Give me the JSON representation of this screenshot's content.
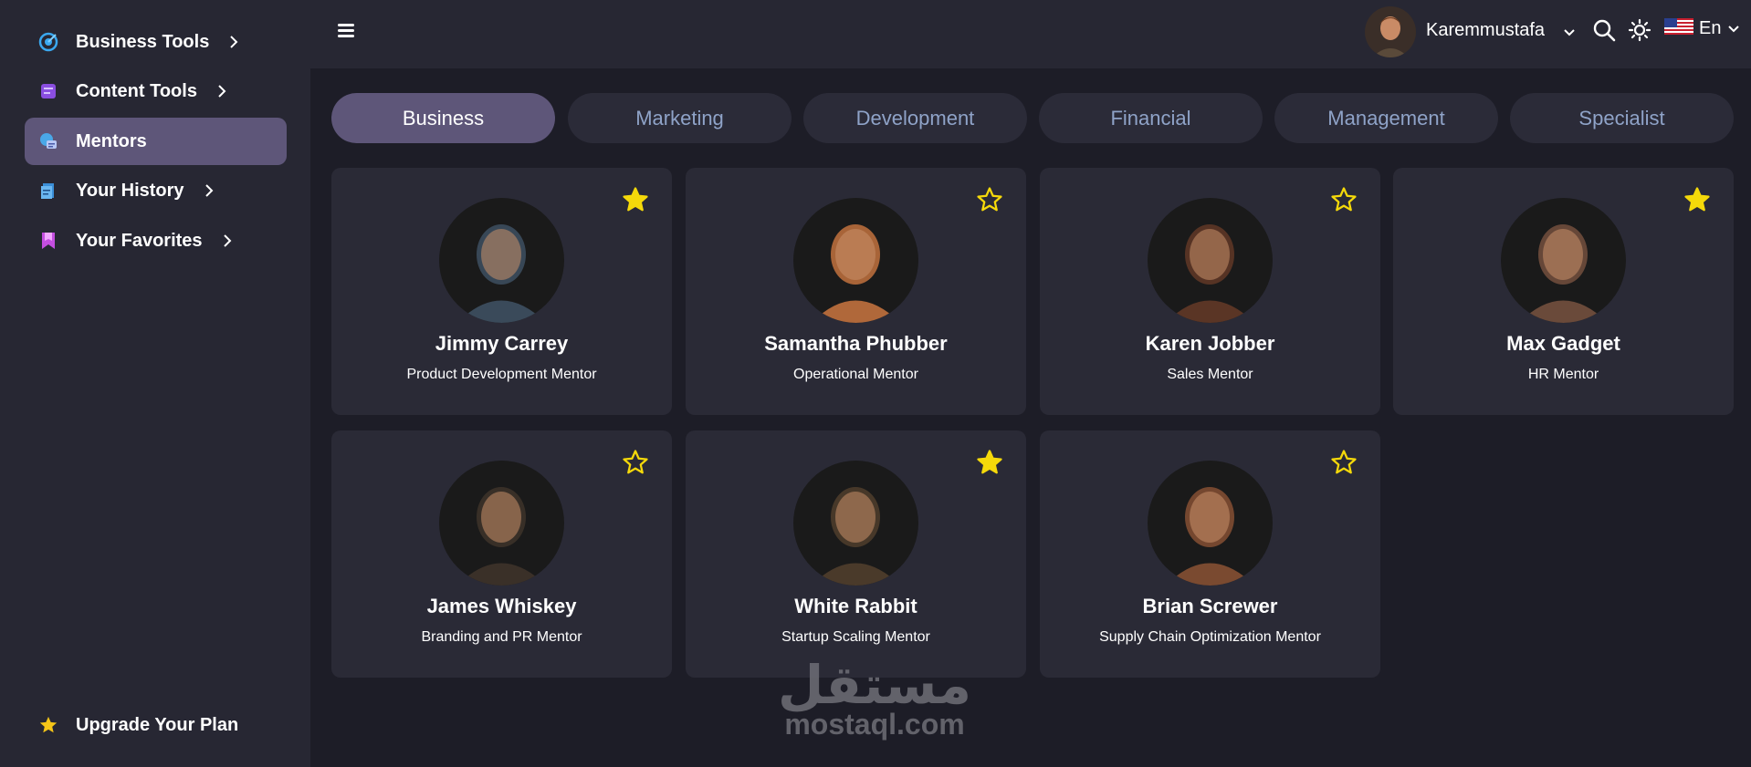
{
  "sidebar": {
    "items": [
      {
        "label": "Business Tools",
        "icon": "target-icon",
        "active": false,
        "has_chevron": true
      },
      {
        "label": "Content Tools",
        "icon": "content-icon",
        "active": false,
        "has_chevron": true
      },
      {
        "label": "Mentors",
        "icon": "mentors-icon",
        "active": true,
        "has_chevron": false
      },
      {
        "label": "Your History",
        "icon": "history-icon",
        "active": false,
        "has_chevron": true
      },
      {
        "label": "Your Favorites",
        "icon": "bookmark-icon",
        "active": false,
        "has_chevron": true
      }
    ],
    "upgrade_label": "Upgrade Your Plan"
  },
  "header": {
    "username": "Karemmustafa",
    "language": "En"
  },
  "tabs": [
    "Business",
    "Marketing",
    "Development",
    "Financial",
    "Management",
    "Specialist"
  ],
  "active_tab": "Business",
  "mentors": [
    {
      "name": "Jimmy Carrey",
      "role": "Product Development Mentor",
      "favorite": true,
      "color": "#3a4a5a"
    },
    {
      "name": "Samantha Phubber",
      "role": "Operational Mentor",
      "favorite": false,
      "color": "#b0683a"
    },
    {
      "name": "Karen Jobber",
      "role": "Sales Mentor",
      "favorite": false,
      "color": "#5a3525"
    },
    {
      "name": "Max Gadget",
      "role": "HR Mentor",
      "favorite": true,
      "color": "#6a4a3a"
    },
    {
      "name": "James Whiskey",
      "role": "Branding and PR Mentor",
      "favorite": false,
      "color": "#3a3028"
    },
    {
      "name": "White Rabbit",
      "role": "Startup Scaling Mentor",
      "favorite": true,
      "color": "#4a3a2a"
    },
    {
      "name": "Brian Screwer",
      "role": "Supply Chain Optimization Mentor",
      "favorite": false,
      "color": "#7a4a30"
    }
  ],
  "watermark": {
    "arabic": "مستقل",
    "latin": "mostaql.com"
  },
  "colors": {
    "background": "#1d1d27",
    "panel": "#272733",
    "card": "#2a2a36",
    "accent": "#5e5679",
    "star": "#f5d90a",
    "tab_text": "#8fa3c8"
  }
}
